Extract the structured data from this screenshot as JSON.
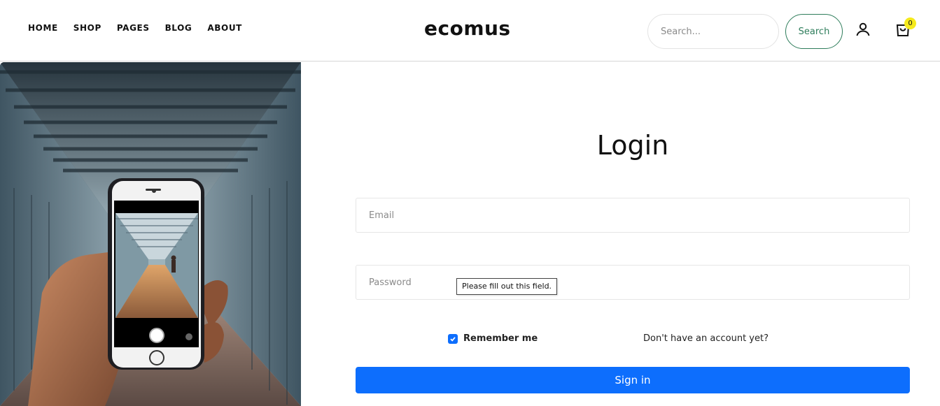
{
  "nav": {
    "items": [
      "HOME",
      "SHOP",
      "PAGES",
      "BLOG",
      "ABOUT"
    ]
  },
  "brand": {
    "logo": "ecomus"
  },
  "search": {
    "placeholder": "Search...",
    "button_label": "Search"
  },
  "cart": {
    "count": "0",
    "badge_color": "#f5ea1c"
  },
  "icons": {
    "account": "user-icon",
    "cart": "cart-icon",
    "checkbox": "check-icon"
  },
  "login": {
    "title": "Login",
    "email_placeholder": "Email",
    "password_placeholder": "Password",
    "validation_tooltip": "Please fill out this field.",
    "remember_label": "Remember me",
    "remember_checked": true,
    "signup_link": "Don't have an account yet?",
    "submit_label": "Sign in"
  },
  "colors": {
    "accent": "#0d6efd",
    "search_button": "#2e7d5b"
  }
}
